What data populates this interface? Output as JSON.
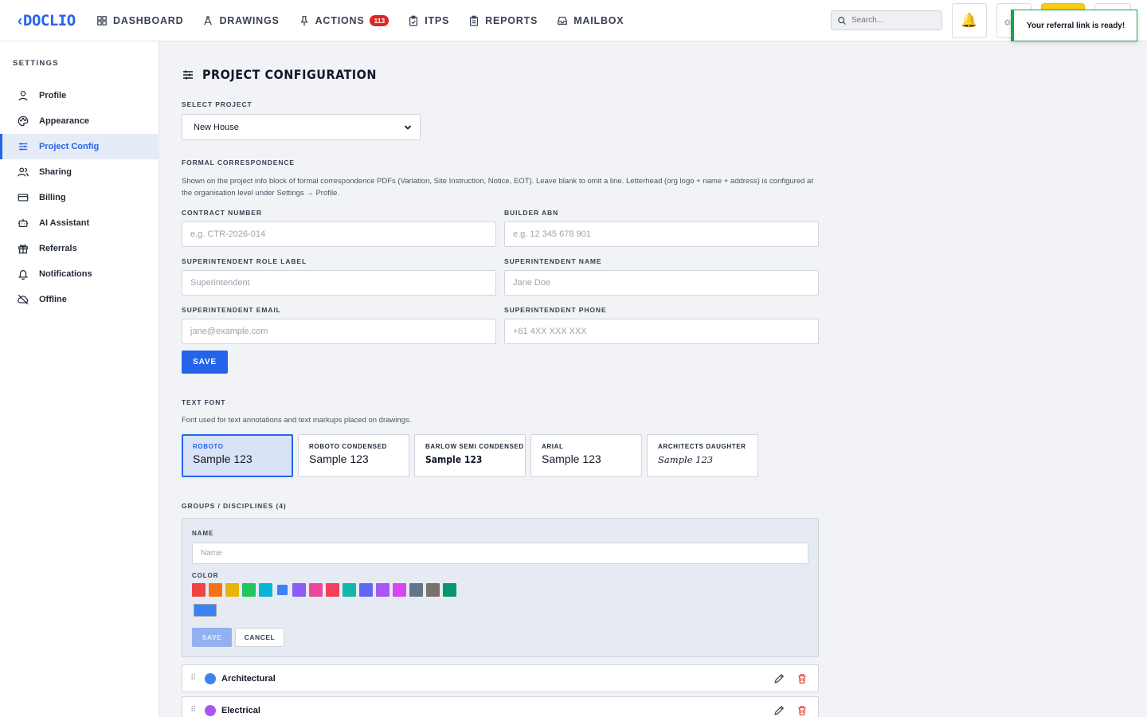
{
  "app": {
    "logo_text": "DOCLIO",
    "nav": [
      {
        "label": "DASHBOARD",
        "icon": "grid-icon"
      },
      {
        "label": "DRAWINGS",
        "icon": "compass-icon"
      },
      {
        "label": "ACTIONS",
        "icon": "pin-icon",
        "badge": "113"
      },
      {
        "label": "ITPS",
        "icon": "clipboard-check-icon"
      },
      {
        "label": "REPORTS",
        "icon": "clipboard-list-icon"
      },
      {
        "label": "MAILBOX",
        "icon": "inbox-icon"
      }
    ],
    "search_placeholder": "Search...",
    "toast": "Your referral link is ready!"
  },
  "sidebar": {
    "title": "SETTINGS",
    "items": [
      {
        "label": "Profile",
        "icon": "user-icon"
      },
      {
        "label": "Appearance",
        "icon": "palette-icon"
      },
      {
        "label": "Project Config",
        "icon": "sliders-icon",
        "active": true
      },
      {
        "label": "Sharing",
        "icon": "users-icon"
      },
      {
        "label": "Billing",
        "icon": "credit-card-icon"
      },
      {
        "label": "AI Assistant",
        "icon": "bot-icon"
      },
      {
        "label": "Referrals",
        "icon": "gift-icon"
      },
      {
        "label": "Notifications",
        "icon": "bell-icon"
      },
      {
        "label": "Offline",
        "icon": "cloud-off-icon"
      }
    ]
  },
  "main": {
    "title": "PROJECT CONFIGURATION",
    "select_project": {
      "label": "SELECT PROJECT",
      "value": "New House"
    },
    "formal": {
      "heading": "FORMAL CORRESPONDENCE",
      "description": "Shown on the project info block of formal correspondence PDFs (Variation, Site Instruction, Notice, EOT). Leave blank to omit a line. Letterhead (org logo + name + address) is configured at the organisation level under Settings → Profile.",
      "contract_number": {
        "label": "CONTRACT NUMBER",
        "placeholder": "e.g. CTR-2026-014"
      },
      "builder_abn": {
        "label": "BUILDER ABN",
        "placeholder": "e.g. 12 345 678 901"
      },
      "super_role": {
        "label": "SUPERINTENDENT ROLE LABEL",
        "placeholder": "Superintendent"
      },
      "super_name": {
        "label": "SUPERINTENDENT NAME",
        "placeholder": "Jane Doe"
      },
      "super_email": {
        "label": "SUPERINTENDENT EMAIL",
        "placeholder": "jane@example.com"
      },
      "super_phone": {
        "label": "SUPERINTENDENT PHONE",
        "placeholder": "+61 4XX XXX XXX"
      },
      "save_label": "SAVE"
    },
    "text_font": {
      "heading": "TEXT FONT",
      "description": "Font used for text annotations and text markups placed on drawings.",
      "options": [
        {
          "name": "ROBOTO",
          "sample": "Sample 123",
          "selected": true
        },
        {
          "name": "ROBOTO CONDENSED",
          "sample": "Sample 123"
        },
        {
          "name": "BARLOW SEMI CONDENSED",
          "sample": "Sample 123"
        },
        {
          "name": "ARIAL",
          "sample": "Sample 123"
        },
        {
          "name": "ARCHITECTS DAUGHTER",
          "sample": "Sample 123"
        }
      ]
    },
    "groups": {
      "heading": "GROUPS / DISCIPLINES (4)",
      "name_label": "NAME",
      "name_placeholder": "Name",
      "color_label": "COLOR",
      "colors": [
        "#ef4444",
        "#f97316",
        "#eab308",
        "#22c55e",
        "#06b6d4",
        "#3b82f6",
        "#8b5cf6",
        "#ec4899",
        "#f43f5e",
        "#14b8a6",
        "#6366f1",
        "#a855f7",
        "#d946ef",
        "#64748b",
        "#78716c",
        "#059669"
      ],
      "selected_color": "#3b82f6",
      "save_label": "SAVE",
      "cancel_label": "CANCEL",
      "rows": [
        {
          "name": "Architectural",
          "color": "#3b82f6"
        },
        {
          "name": "Electrical",
          "color": "#a855f7"
        }
      ]
    }
  }
}
